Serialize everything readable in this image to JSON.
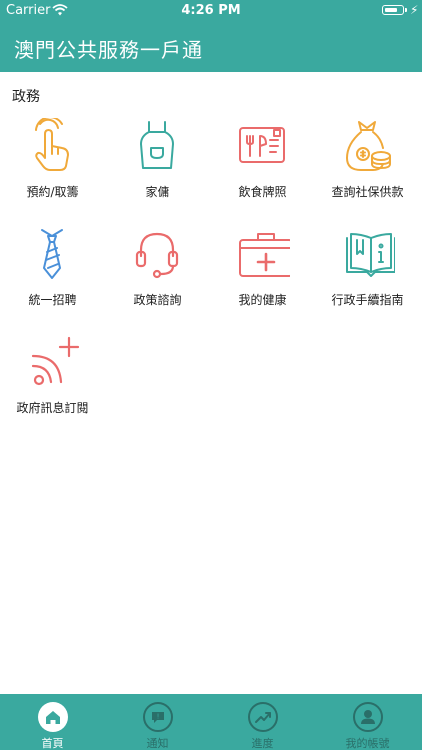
{
  "status_bar": {
    "carrier": "Carrier",
    "time": "4:26 PM",
    "battery_level": 0.75
  },
  "app": {
    "title": "澳門公共服務一戶通"
  },
  "section": {
    "title": "政務"
  },
  "services": [
    {
      "label": "預約/取籌",
      "icon": "tap-hand-icon",
      "color": "#f0a93a"
    },
    {
      "label": "家傭",
      "icon": "apron-icon",
      "color": "#3aa99f"
    },
    {
      "label": "飲食牌照",
      "icon": "dining-license-icon",
      "color": "#ea6b6b"
    },
    {
      "label": "查詢社保供款",
      "icon": "money-bag-icon",
      "color": "#f0a93a"
    },
    {
      "label": "統一招聘",
      "icon": "necktie-icon",
      "color": "#4a90d9"
    },
    {
      "label": "政策諮詢",
      "icon": "headset-icon",
      "color": "#ea6b6b"
    },
    {
      "label": "我的健康",
      "icon": "first-aid-kit-icon",
      "color": "#ea6b6b"
    },
    {
      "label": "行政手續指南",
      "icon": "open-book-icon",
      "color": "#3aa99f"
    },
    {
      "label": "政府訊息訂閱",
      "icon": "rss-subscribe-icon",
      "color": "#ea6b6b"
    }
  ],
  "tabs": [
    {
      "label": "首頁",
      "icon": "home-icon",
      "active": true
    },
    {
      "label": "通知",
      "icon": "message-icon",
      "active": false
    },
    {
      "label": "進度",
      "icon": "trend-icon",
      "active": false
    },
    {
      "label": "我的帳號",
      "icon": "person-icon",
      "active": false
    }
  ],
  "colors": {
    "primary": "#3aa99f",
    "tab_inactive": "#2a6f69"
  }
}
